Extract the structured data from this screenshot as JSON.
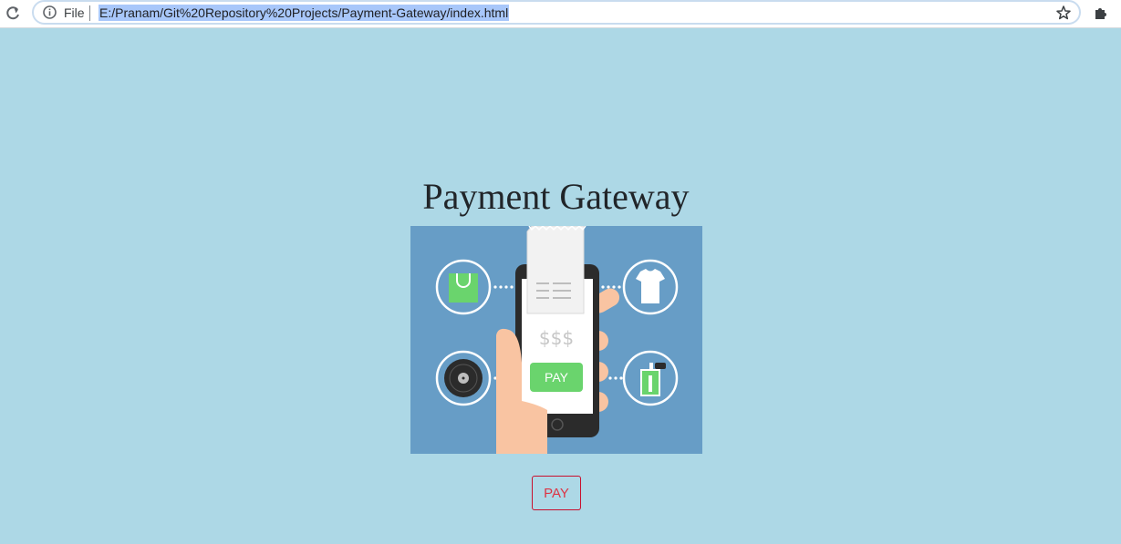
{
  "browser": {
    "scheme_label": "File",
    "url": "E:/Pranam/Git%20Repository%20Projects/Payment-Gateway/index.html"
  },
  "page": {
    "title": "Payment Gateway",
    "pay_button_label": "PAY",
    "illustration": {
      "receipt_amount": "$$$",
      "phone_pay_label": "PAY",
      "icons": [
        "shopping-bag-icon",
        "tshirt-icon",
        "vinyl-record-icon",
        "perfume-bottle-icon"
      ]
    }
  },
  "colors": {
    "page_background": "#add8e6",
    "illustration_background": "#679dc6",
    "pay_button_border": "#c8102e",
    "pay_button_text": "#dc3545",
    "phone_pay_green": "#6ad46d"
  }
}
